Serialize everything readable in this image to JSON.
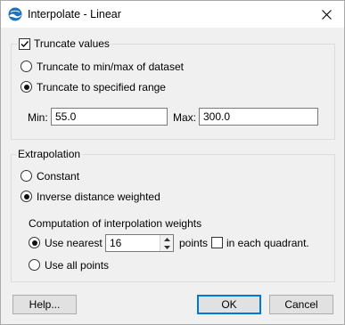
{
  "window": {
    "title": "Interpolate - Linear",
    "app_icon": "globe-icon",
    "close_icon": "close-icon"
  },
  "truncate": {
    "label": "Truncate values",
    "checked": true,
    "options": [
      {
        "label": "Truncate to min/max of dataset",
        "selected": false
      },
      {
        "label": "Truncate to specified range",
        "selected": true
      }
    ],
    "min_label": "Min:",
    "min_value": "55.0",
    "max_label": "Max:",
    "max_value": "300.0"
  },
  "extrapolation": {
    "legend": "Extrapolation",
    "options": [
      {
        "label": "Constant",
        "selected": false
      },
      {
        "label": "Inverse distance weighted",
        "selected": true
      }
    ],
    "weights_heading": "Computation of interpolation weights",
    "use_nearest_label": "Use nearest",
    "nearest_count": "16",
    "points_label": "points",
    "quadrant_label": "in each quadrant.",
    "quadrant_checked": false,
    "use_all_label": "Use all points"
  },
  "buttons": {
    "help": "Help...",
    "ok": "OK",
    "cancel": "Cancel"
  },
  "colors": {
    "accent": "#0078d7",
    "dialog_bg": "#f0f0f0"
  }
}
